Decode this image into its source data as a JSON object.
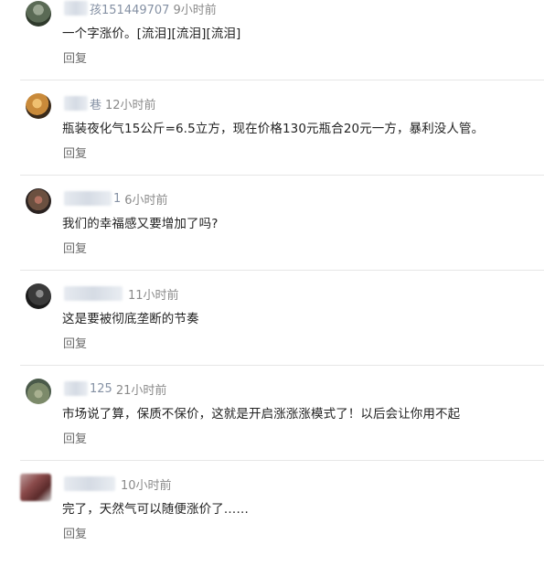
{
  "comments": [
    {
      "username_suffix": "孩151449707",
      "time": "9小时前",
      "text": "一个字涨价。[流泪][流泪][流泪]",
      "reply": "回复",
      "avatar_colors": [
        "#5a6a55",
        "#2f3a2c"
      ]
    },
    {
      "username_suffix": "巷",
      "time": "12小时前",
      "text": "瓶装夜化气15公斤=6.5立方，现在价格130元瓶合20元一方，暴利没人管。",
      "reply": "回复",
      "avatar_colors": [
        "#c98a3a",
        "#3a2a1a"
      ]
    },
    {
      "username_suffix": "1",
      "time": "6小时前",
      "text": "我们的幸福感又要增加了吗?",
      "reply": "回复",
      "avatar_colors": [
        "#6b5040",
        "#2a2220"
      ]
    },
    {
      "username_suffix": "",
      "time": "11小时前",
      "text": "这是要被彻底垄断的节奏",
      "reply": "回复",
      "avatar_colors": [
        "#3a3a3a",
        "#1a1a1a"
      ]
    },
    {
      "username_suffix": "125",
      "time": "21小时前",
      "text": "市场说了算，保质不保价，这就是开启涨涨涨模式了！以后会让你用不起",
      "reply": "回复",
      "avatar_colors": [
        "#7c8a6a",
        "#4a5a4a"
      ]
    },
    {
      "username_suffix": "",
      "time": "10小时前",
      "text": "完了，天然气可以随便涨价了……",
      "reply": "回复",
      "avatar_colors": [
        "#8a4a4a",
        "#5a2a2a"
      ]
    }
  ]
}
